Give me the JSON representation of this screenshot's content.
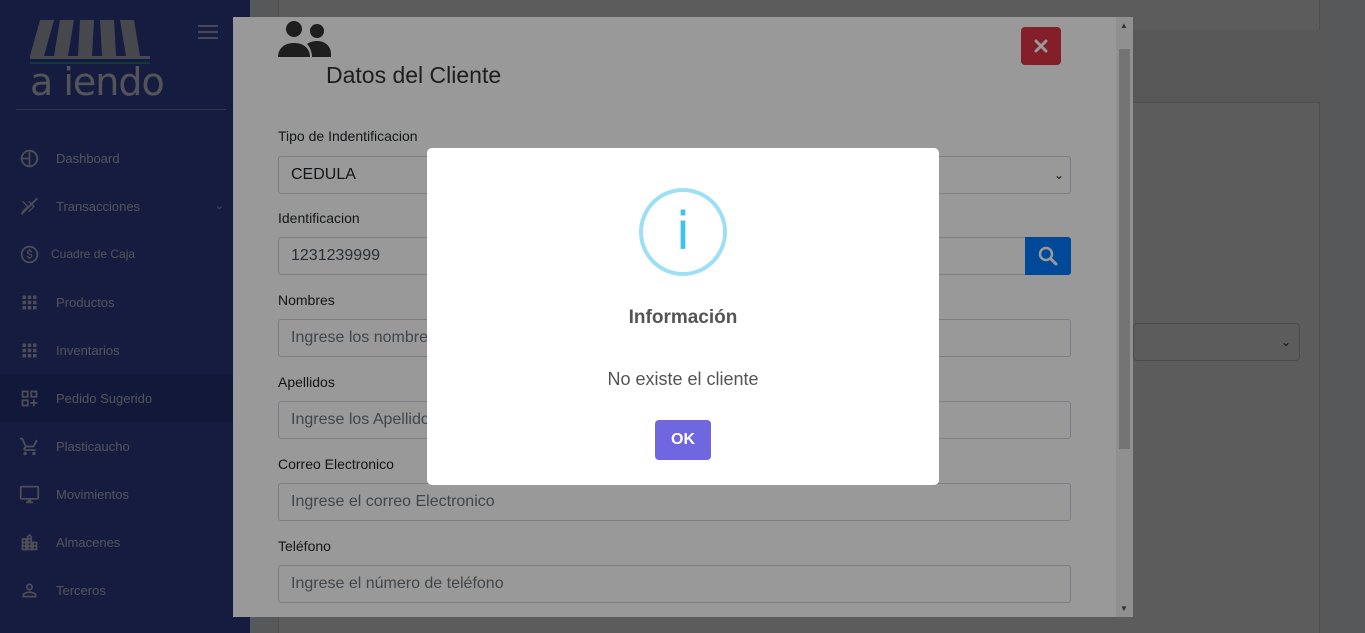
{
  "brand": {
    "logo_text": "a iendo"
  },
  "sidebar": {
    "items": [
      {
        "label": "Dashboard",
        "icon": "dashboard-icon"
      },
      {
        "label": "Transacciones",
        "icon": "transactions-icon"
      },
      {
        "label": "Cuadre de Caja",
        "icon": "dollar-icon"
      },
      {
        "label": "Productos",
        "icon": "grid-icon"
      },
      {
        "label": "Inventarios",
        "icon": "grid-icon"
      },
      {
        "label": "Pedido Sugerido",
        "icon": "suggested-order-icon"
      },
      {
        "label": "Plasticaucho",
        "icon": "cart-icon"
      },
      {
        "label": "Movimientos",
        "icon": "monitor-icon"
      },
      {
        "label": "Almacenes",
        "icon": "building-icon"
      },
      {
        "label": "Terceros",
        "icon": "person-icon"
      }
    ],
    "active_index": 5
  },
  "modal": {
    "title": "Datos del Cliente",
    "fields": {
      "tipo_label": "Tipo de Indentificacion",
      "tipo_value": "CEDULA",
      "id_label": "Identificacion",
      "id_value": "1231239999",
      "nombres_label": "Nombres",
      "nombres_placeholder": "Ingrese los nombres",
      "apellidos_label": "Apellidos",
      "apellidos_placeholder": "Ingrese los Apellidos",
      "correo_label": "Correo Electronico",
      "correo_placeholder": "Ingrese el correo Electronico",
      "telefono_label": "Teléfono",
      "telefono_placeholder": "Ingrese el número de teléfono"
    }
  },
  "alert": {
    "icon": "i",
    "title": "Información",
    "text": "No existe el cliente",
    "ok_label": "OK"
  },
  "colors": {
    "sidebar": "#3f51b5",
    "close_button": "#dc3545",
    "search_button": "#007bff",
    "ok_button": "#7066e0",
    "info_icon": "#3fc3ee"
  }
}
